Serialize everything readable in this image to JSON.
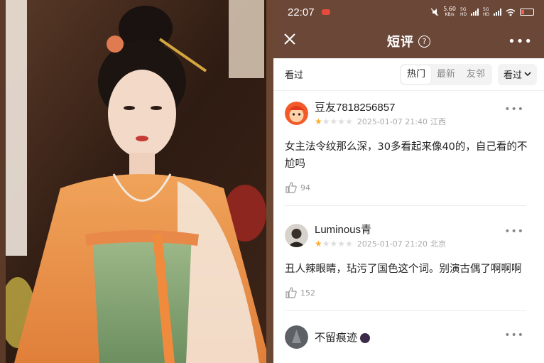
{
  "statusbar": {
    "time": "22:07",
    "net_speed": "5.60",
    "net_unit": "KB/s",
    "sig1": "5G HD",
    "sig2": "5G HD"
  },
  "topbar": {
    "title": "短评",
    "help": "?",
    "more": "•••"
  },
  "filter": {
    "label": "看过",
    "tabs": [
      "热门",
      "最新",
      "友邻"
    ],
    "active_tab": "热门",
    "sort": "看过"
  },
  "reviews": [
    {
      "user": "豆友7818256857",
      "rating": 1,
      "date": "2025-01-07 21:40",
      "location": "江西",
      "text": "女主法令纹那么深，30多看起来像40的，自己看的不尬吗",
      "likes": "94"
    },
    {
      "user": "Luminous青",
      "rating": 1,
      "date": "2025-01-07 21:20",
      "location": "北京",
      "text": "丑人辣眼睛，玷污了国色这个词。别演古偶了啊啊啊",
      "likes": "152"
    },
    {
      "user": "不留痕迹",
      "rating": 1,
      "date": "",
      "location": "",
      "text": "",
      "likes": ""
    }
  ],
  "colors": {
    "header_bg": "#6b4737",
    "star_on": "#ffac2d",
    "star_off": "#dddddd"
  }
}
